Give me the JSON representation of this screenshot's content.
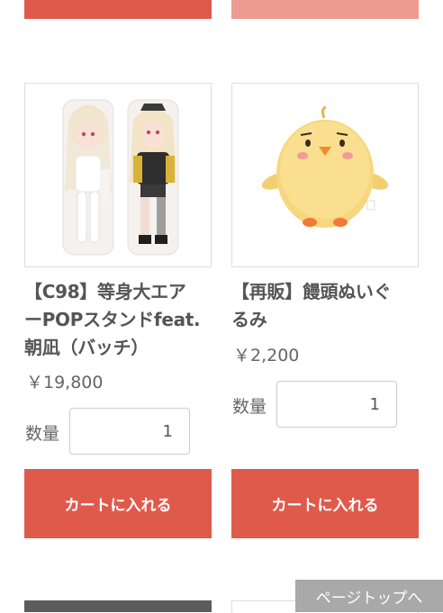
{
  "products": [
    {
      "title_lines": [
        "【C98】等身大エア",
        "ーPOPスタンドfeat.",
        "朝凪（バッチ）"
      ],
      "price": "￥19,800",
      "qty_label": "数量",
      "qty_value": "1",
      "cart_label": "カートに入れる"
    },
    {
      "title_lines": [
        "【再販】饅頭ぬいぐ",
        "るみ"
      ],
      "price": "￥2,200",
      "qty_label": "数量",
      "qty_value": "1",
      "cart_label": "カートに入れる"
    }
  ],
  "page_top_label": "ページトップへ",
  "colors": {
    "accent": "#e05a4c",
    "accent_light": "#ee9b91",
    "text": "#555555",
    "page_top_bg": "#a9a9a9"
  }
}
